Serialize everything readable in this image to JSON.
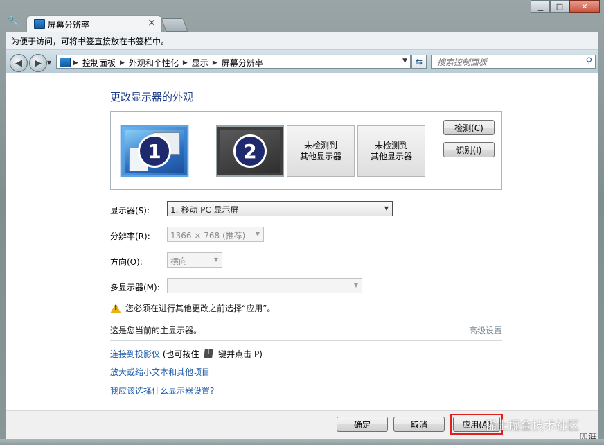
{
  "window": {
    "tab_title": "屏幕分辨率",
    "minimize": "▁",
    "maximize": "□",
    "close": "✕"
  },
  "bookmark_bar": {
    "text": "为便于访问，可将书签直接放在书签栏中。"
  },
  "address_bar": {
    "crumbs": [
      "控制面板",
      "外观和个性化",
      "显示",
      "屏幕分辨率"
    ],
    "search_placeholder": "搜索控制面板"
  },
  "main": {
    "heading": "更改显示器的外观",
    "monitors": [
      {
        "number": "1",
        "selected": true
      },
      {
        "number": "2",
        "selected": false
      },
      {
        "label": "未检测到\n其他显示器"
      },
      {
        "label": "未检测到\n其他显示器"
      }
    ],
    "detect_button": "检测(C)",
    "identify_button": "识别(I)",
    "display_label": "显示器(S):",
    "display_value": "1. 移动 PC 显示屏",
    "resolution_label": "分辨率(R):",
    "resolution_value": "1366 × 768 (推荐)",
    "orientation_label": "方向(O):",
    "orientation_value": "横向",
    "multi_label": "多显示器(M):",
    "multi_value": "",
    "warning": "您必须在进行其他更改之前选择“应用”。",
    "primary_note": "这是您当前的主显示器。",
    "advanced_link": "高级设置",
    "link_projector": "连接到投影仪",
    "link_projector_suffix_a": " (也可按住 ",
    "link_projector_suffix_b": " 键并点击 P)",
    "link_text_size": "放大或缩小文本和其他项目",
    "link_which_settings": "我应该选择什么显示器设置?"
  },
  "footer": {
    "ok": "确定",
    "cancel": "取消",
    "apply": "应用(A)"
  },
  "watermark": "稀土掘金技术社区",
  "watermark_author": "即涯",
  "colors": {
    "heading": "#1e3e8a",
    "link": "#1a5aa8",
    "highlight_border": "#e02020",
    "warning_icon": "#e8b21a"
  }
}
